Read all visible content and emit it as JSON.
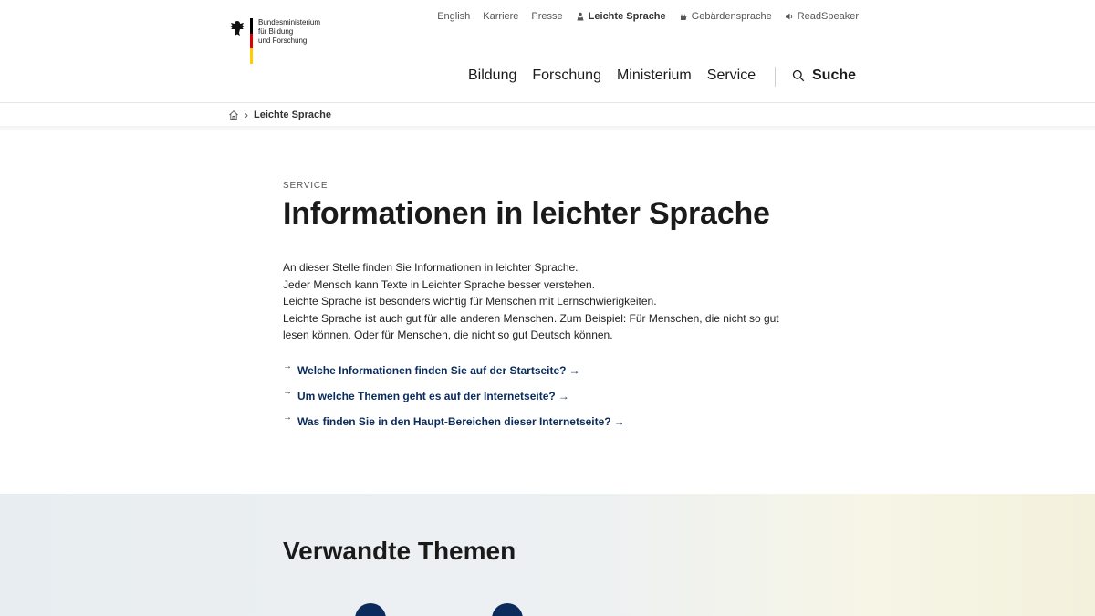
{
  "header": {
    "logo_lines": [
      "Bundesministerium",
      "für Bildung",
      "und Forschung"
    ],
    "meta_nav": [
      {
        "label": "English",
        "icon": ""
      },
      {
        "label": "Karriere",
        "icon": ""
      },
      {
        "label": "Presse",
        "icon": ""
      },
      {
        "label": "Leichte Sprache",
        "icon": "easy-language-icon"
      },
      {
        "label": "Gebärdensprache",
        "icon": "sign-language-icon"
      },
      {
        "label": "ReadSpeaker",
        "icon": "speaker-icon"
      }
    ],
    "main_nav": [
      "Bildung",
      "Forschung",
      "Ministerium",
      "Service"
    ],
    "search_label": "Suche"
  },
  "breadcrumb": {
    "home_icon": "home-icon",
    "separator": "›",
    "current": "Leichte Sprache"
  },
  "content": {
    "kicker": "SERVICE",
    "title": "Informationen in leichter Sprache",
    "intro": [
      "An dieser Stelle finden Sie Informationen in leichter Sprache.",
      "Jeder Mensch kann Texte in Leichter Sprache besser verstehen.",
      "Leichte Sprache ist besonders wichtig für Menschen mit Lernschwierigkeiten.",
      "Leichte Sprache ist auch gut für alle anderen Menschen. Zum Beispiel: Für Menschen, die nicht so gut lesen können. Oder für Menschen, die nicht so gut Deutsch können."
    ],
    "links": [
      "Welche Informationen finden Sie auf der Startseite?",
      "Um welche Themen geht es auf der Internetseite?",
      "Was finden Sie in den Haupt-Bereichen dieser Internetseite?"
    ],
    "link_arrow": "→",
    "link_prefix": "→"
  },
  "related": {
    "title": "Verwandte Themen"
  },
  "colors": {
    "link": "#0a2b5c",
    "flag_black": "#000000",
    "flag_red": "#dd0000",
    "flag_gold": "#ffcc00"
  }
}
